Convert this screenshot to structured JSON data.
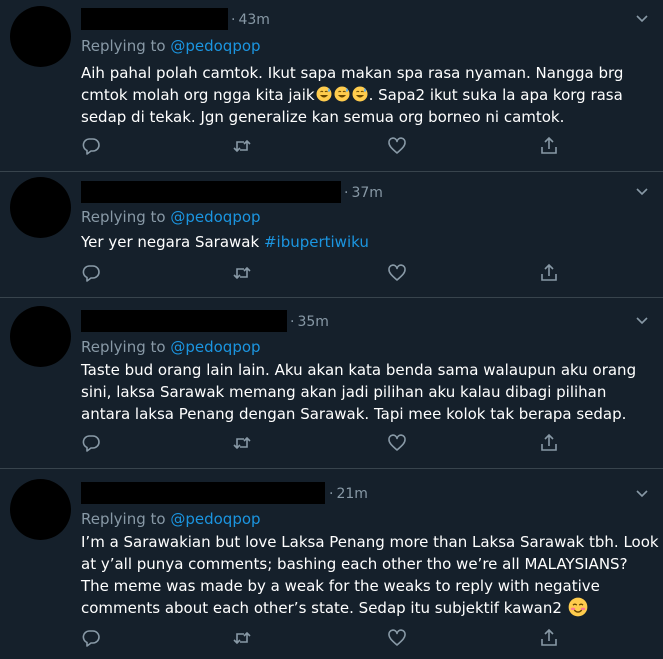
{
  "tweets": [
    {
      "time": "43m",
      "replying_prefix": "Replying to",
      "replying_handle": "@pedoqpop",
      "text_a": "Aih pahal polah camtok. Ikut sapa makan spa rasa nyaman. Nangga brg cmtok molah org ngga kita jaik",
      "text_b": ". Sapa2 ikut suka la apa korg rasa sedap di tekak. Jgn generalize kan semua org borneo ni camtok.",
      "emojis": [
        "grinning-sweat-emoji",
        "grinning-sweat-emoji",
        "grinning-sweat-emoji"
      ]
    },
    {
      "time": "37m",
      "replying_prefix": "Replying to",
      "replying_handle": "@pedoqpop",
      "text_a": "Yer yer negara Sarawak",
      "hashtag": "#ibupertiwiku"
    },
    {
      "time": "35m",
      "replying_prefix": "Replying to",
      "replying_handle": "@pedoqpop",
      "text_a": "Taste bud orang lain lain. Aku akan kata benda sama walaupun aku orang sini, laksa Sarawak memang akan jadi pilihan aku kalau dibagi pilihan antara laksa Penang dengan Sarawak. Tapi mee kolok tak berapa sedap."
    },
    {
      "time": "21m",
      "replying_prefix": "Replying to",
      "replying_handle": "@pedoqpop",
      "text_a": "I’m a Sarawakian but love Laksa Penang more than Laksa Sarawak tbh. Look at y’all punya comments; bashing each other tho we’re all MALAYSIANS? The meme was made by a weak for the weaks to reply with negative comments about each other’s state. Sedap itu subjektif kawan2",
      "emojis": [
        "smiling-blush-emoji"
      ]
    }
  ],
  "colors": {
    "background": "#15202b",
    "divider": "#38444d",
    "muted": "#8899a6",
    "link": "#1b95e0",
    "text": "#ffffff"
  },
  "icons": [
    "reply-icon",
    "retweet-icon",
    "like-icon",
    "share-icon",
    "more-caret-icon"
  ]
}
